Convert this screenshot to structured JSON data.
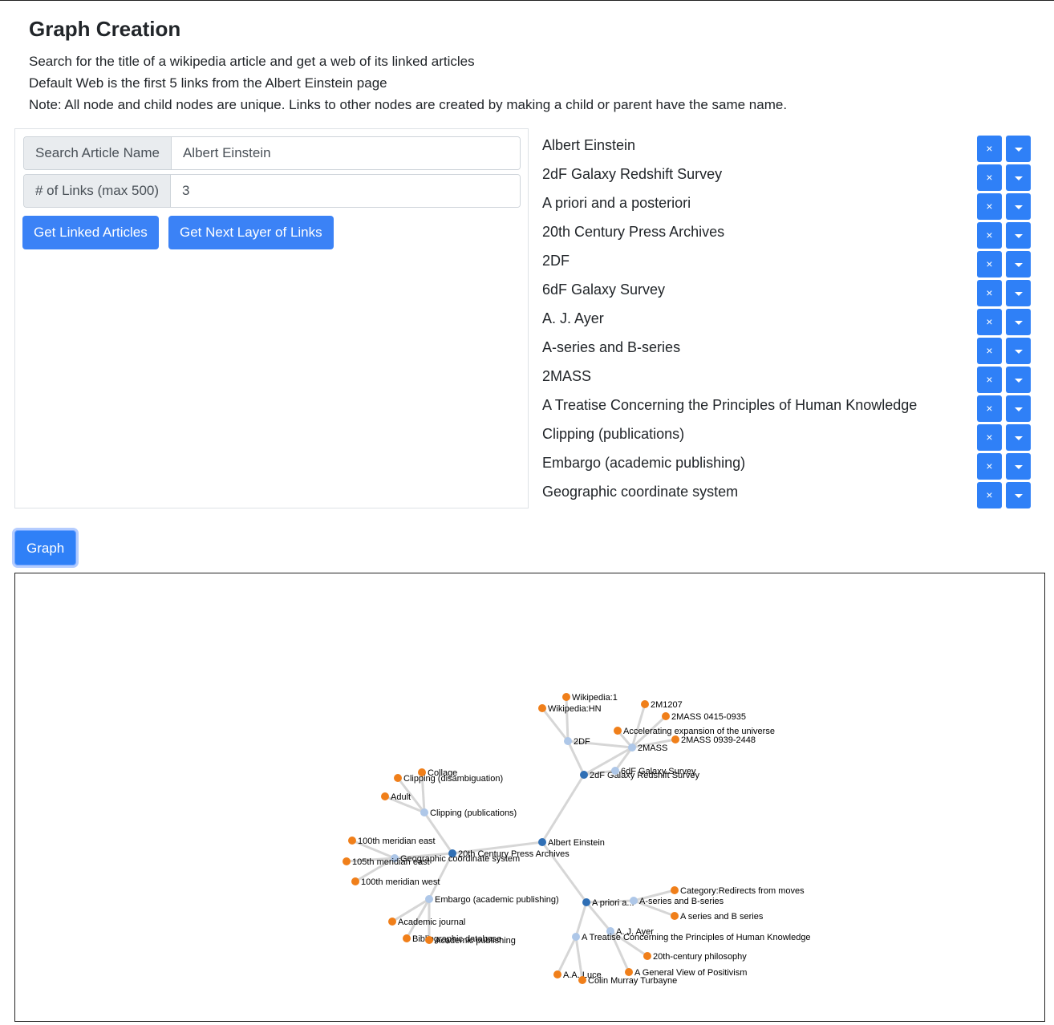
{
  "page": {
    "title": "Graph Creation",
    "description": [
      "Search for the title of a wikipedia article and get a web of its linked articles",
      "Default Web is the first 5 links from the Albert Einstein page",
      "Note: All node and child nodes are unique. Links to other nodes are created by making a child or parent have the same name."
    ]
  },
  "search": {
    "article_label": "Search Article Name",
    "article_value": "Albert Einstein",
    "links_label": "# of Links (max 500)",
    "links_value": "3",
    "get_linked_label": "Get Linked Articles",
    "get_next_label": "Get Next Layer of Links"
  },
  "node_list": [
    "Albert Einstein",
    "2dF Galaxy Redshift Survey",
    "A priori and a posteriori",
    "20th Century Press Archives",
    "2DF",
    "6dF Galaxy Survey",
    "A. J. Ayer",
    "A-series and B-series",
    "2MASS",
    "A Treatise Concerning the Principles of Human Knowledge",
    "Clipping (publications)",
    "Embargo (academic publishing)",
    "Geographic coordinate system"
  ],
  "remove_symbol": "×",
  "graph_button_label": "Graph",
  "colors": {
    "root": "#2f6fb5",
    "level1": "#aec7e8",
    "leaf": "#f07f1a",
    "link": "#cccccc"
  },
  "graph": {
    "nodes": [
      {
        "id": "Albert Einstein",
        "group": "root"
      },
      {
        "id": "2dF Galaxy Redshift Survey",
        "group": "root"
      },
      {
        "id": "A priori and a posteriori",
        "group": "root",
        "label": "A priori a..."
      },
      {
        "id": "20th Century Press Archives",
        "group": "root"
      },
      {
        "id": "2DF",
        "group": "level1"
      },
      {
        "id": "6dF Galaxy Survey",
        "group": "level1"
      },
      {
        "id": "2MASS",
        "group": "level1"
      },
      {
        "id": "A. J. Ayer",
        "group": "level1"
      },
      {
        "id": "A-series and B-series",
        "group": "level1"
      },
      {
        "id": "A Treatise Concerning the Principles of Human Knowledge",
        "group": "level1"
      },
      {
        "id": "Clipping (publications)",
        "group": "level1"
      },
      {
        "id": "Embargo (academic publishing)",
        "group": "level1"
      },
      {
        "id": "Geographic coordinate system",
        "group": "level1"
      },
      {
        "id": "Wikipedia:1",
        "group": "leaf"
      },
      {
        "id": "Wikipedia:HN",
        "group": "leaf"
      },
      {
        "id": "2M1207",
        "group": "leaf"
      },
      {
        "id": "2MASS 0415-0935",
        "group": "leaf"
      },
      {
        "id": "Accelerating expansion of the universe",
        "group": "leaf"
      },
      {
        "id": "2MASS 0939-2448",
        "group": "leaf"
      },
      {
        "id": "Collage",
        "group": "leaf"
      },
      {
        "id": "Clipping (disambiguation)",
        "group": "leaf"
      },
      {
        "id": "Adult",
        "group": "leaf"
      },
      {
        "id": "100th meridian east",
        "group": "leaf"
      },
      {
        "id": "105th meridian east",
        "group": "leaf"
      },
      {
        "id": "100th meridian west",
        "group": "leaf"
      },
      {
        "id": "Academic journal",
        "group": "leaf"
      },
      {
        "id": "Bibliographic database",
        "group": "leaf"
      },
      {
        "id": "Academic publishing",
        "group": "leaf"
      },
      {
        "id": "Category:Redirects from moves",
        "group": "leaf"
      },
      {
        "id": "A series and B series",
        "group": "leaf"
      },
      {
        "id": "20th-century philosophy",
        "group": "leaf"
      },
      {
        "id": "A General View of Positivism",
        "group": "leaf"
      },
      {
        "id": "A.A. Luce",
        "group": "leaf"
      },
      {
        "id": "Colin Murray Turbayne",
        "group": "leaf"
      }
    ]
  }
}
